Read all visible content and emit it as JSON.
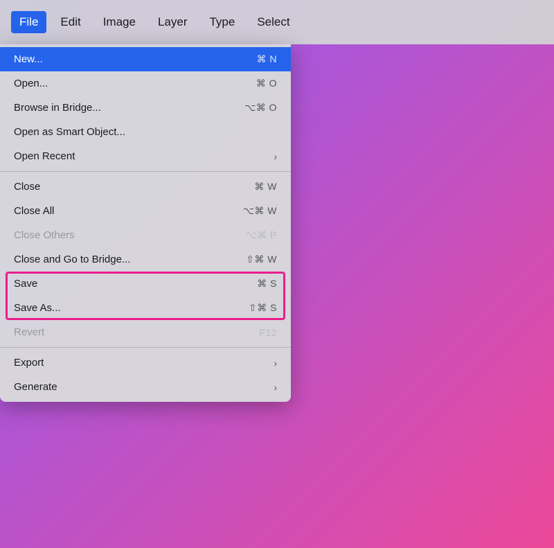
{
  "menubar": {
    "items": [
      {
        "label": "File",
        "active": true
      },
      {
        "label": "Edit",
        "active": false
      },
      {
        "label": "Image",
        "active": false
      },
      {
        "label": "Layer",
        "active": false
      },
      {
        "label": "Type",
        "active": false
      },
      {
        "label": "Select",
        "active": false
      }
    ]
  },
  "dropdown": {
    "items": [
      {
        "label": "New...",
        "shortcut": "⌘ N",
        "highlighted": true,
        "disabled": false,
        "hasArrow": false,
        "dividerAfter": false
      },
      {
        "label": "Open...",
        "shortcut": "⌘ O",
        "highlighted": false,
        "disabled": false,
        "hasArrow": false,
        "dividerAfter": false
      },
      {
        "label": "Browse in Bridge...",
        "shortcut": "⌥⌘ O",
        "highlighted": false,
        "disabled": false,
        "hasArrow": false,
        "dividerAfter": false
      },
      {
        "label": "Open as Smart Object...",
        "shortcut": "",
        "highlighted": false,
        "disabled": false,
        "hasArrow": false,
        "dividerAfter": false
      },
      {
        "label": "Open Recent",
        "shortcut": "",
        "highlighted": false,
        "disabled": false,
        "hasArrow": true,
        "dividerAfter": true
      },
      {
        "label": "Close",
        "shortcut": "⌘ W",
        "highlighted": false,
        "disabled": false,
        "hasArrow": false,
        "dividerAfter": false
      },
      {
        "label": "Close All",
        "shortcut": "⌥⌘ W",
        "highlighted": false,
        "disabled": false,
        "hasArrow": false,
        "dividerAfter": false
      },
      {
        "label": "Close Others",
        "shortcut": "⌥⌘ P",
        "highlighted": false,
        "disabled": true,
        "hasArrow": false,
        "dividerAfter": false
      },
      {
        "label": "Close and Go to Bridge...",
        "shortcut": "⇧⌘ W",
        "highlighted": false,
        "disabled": false,
        "hasArrow": false,
        "dividerAfter": false
      },
      {
        "label": "Save",
        "shortcut": "⌘ S",
        "highlighted": false,
        "disabled": false,
        "hasArrow": false,
        "dividerAfter": false,
        "pinkBox": true
      },
      {
        "label": "Save As...",
        "shortcut": "⇧⌘ S",
        "highlighted": false,
        "disabled": false,
        "hasArrow": false,
        "dividerAfter": false,
        "pinkBox": true
      },
      {
        "label": "Revert",
        "shortcut": "F12",
        "highlighted": false,
        "disabled": true,
        "hasArrow": false,
        "dividerAfter": true
      },
      {
        "label": "Export",
        "shortcut": "",
        "highlighted": false,
        "disabled": false,
        "hasArrow": true,
        "dividerAfter": false
      },
      {
        "label": "Generate",
        "shortcut": "",
        "highlighted": false,
        "disabled": false,
        "hasArrow": true,
        "dividerAfter": false
      }
    ]
  }
}
